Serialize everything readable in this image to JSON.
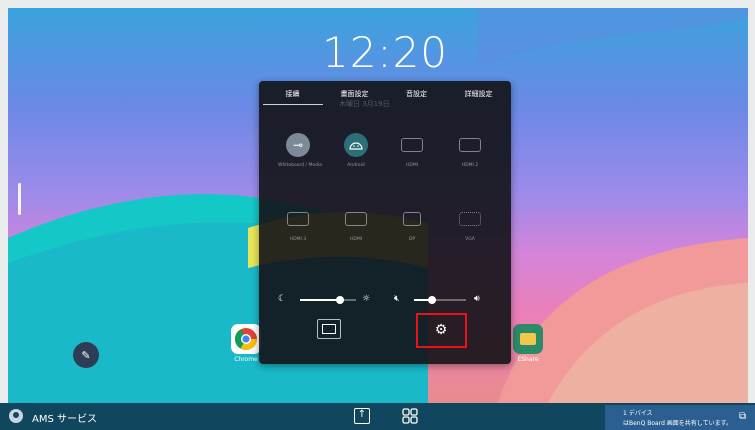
{
  "clock": {
    "time": "12:20"
  },
  "panel": {
    "tabs": [
      "接續",
      "畫面設定",
      "音設定",
      "詳細設定"
    ],
    "active_tab": 0,
    "ghost_text": "木曜日  3月19日",
    "sources_row1": [
      {
        "label": "Whiteboard / Media",
        "icon": "input-source-icon",
        "active": true,
        "color": "#7b8a96"
      },
      {
        "label": "Android",
        "icon": "android-icon",
        "active": true,
        "color": "#2d6f78"
      },
      {
        "label": "HDMI",
        "icon": "hdmi-port-icon",
        "active": false
      },
      {
        "label": "HDMI 2",
        "icon": "hdmi-port-icon",
        "active": false
      }
    ],
    "sources_row2": [
      {
        "label": "HDMI 3",
        "icon": "hdmi-port-icon",
        "active": false
      },
      {
        "label": "HDMI",
        "icon": "hdmi-port-icon",
        "active": false
      },
      {
        "label": "DP",
        "icon": "dp-port-icon",
        "active": false
      },
      {
        "label": "VGA",
        "icon": "vga-port-icon",
        "active": false
      }
    ],
    "brightness_level": 0.72,
    "volume_level": 0.35,
    "settings_button": "gear-icon"
  },
  "apps": [
    {
      "name": "chrome-app",
      "label": "Chrome"
    },
    {
      "name": "play-store-app",
      "label": ""
    },
    {
      "name": "ez-app",
      "label": ""
    },
    {
      "name": "files-app",
      "label": "EShare"
    }
  ],
  "taskbar": {
    "user_name": "AMS サービス",
    "notice_line1": "1 デバイス",
    "notice_line2": "はBenQ Board 画面を共有しています。"
  },
  "colors": {
    "highlight": "#e8141b",
    "taskbar": "#10475e",
    "notice": "#2b5f91"
  }
}
